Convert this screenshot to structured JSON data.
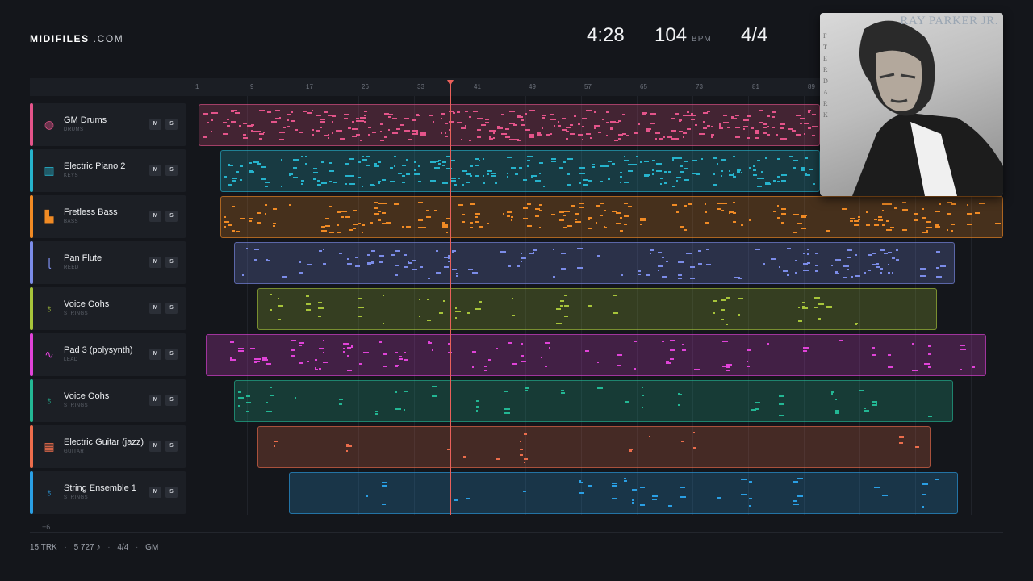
{
  "brand": {
    "name_bold": "MIDIFILES",
    "name_light": ".COM"
  },
  "header": {
    "time": "4:28",
    "bpm": "104",
    "bpm_label": "BPM",
    "signature": "4/4"
  },
  "album": {
    "artist_text": "RAY PARKER JR.",
    "title_letters": [
      "F",
      "T",
      "E",
      "R",
      "D",
      "A",
      "R",
      "K"
    ]
  },
  "ruler": {
    "ticks": [
      "1",
      "9",
      "17",
      "26",
      "33",
      "41",
      "49",
      "57",
      "65",
      "73",
      "81",
      "89"
    ]
  },
  "colors": {
    "drums": "#e4548a",
    "keys": "#26b3cc",
    "bass": "#f08a24",
    "reed": "#7b8ce8",
    "strings_lime": "#a7c43a",
    "lead": "#e043d8",
    "strings_teal": "#23b794",
    "guitar": "#ec6d4c",
    "strings_blue": "#2a9fe4",
    "playhead": "#e9605a"
  },
  "tracks": [
    {
      "name": "GM Drums",
      "category": "DRUMS",
      "icon": "drum-icon",
      "glyph": "◍",
      "color": "#e4548a",
      "mute": "M",
      "solo": "S"
    },
    {
      "name": "Electric Piano 2",
      "category": "KEYS",
      "icon": "piano-icon",
      "glyph": "▥",
      "color": "#26b3cc",
      "mute": "M",
      "solo": "S"
    },
    {
      "name": "Fretless Bass",
      "category": "BASS",
      "icon": "bass-amp-icon",
      "glyph": "▙",
      "color": "#f08a24",
      "mute": "M",
      "solo": "S"
    },
    {
      "name": "Pan Flute",
      "category": "REED",
      "icon": "flute-icon",
      "glyph": "ɭ",
      "color": "#7b8ce8",
      "mute": "M",
      "solo": "S"
    },
    {
      "name": "Voice Oohs",
      "category": "STRINGS",
      "icon": "guitar-icon",
      "glyph": "♁",
      "color": "#a7c43a",
      "mute": "M",
      "solo": "S"
    },
    {
      "name": "Pad 3 (polysynth)",
      "category": "LEAD",
      "icon": "waveform-icon",
      "glyph": "∿",
      "color": "#e043d8",
      "mute": "M",
      "solo": "S"
    },
    {
      "name": "Voice Oohs",
      "category": "STRINGS",
      "icon": "guitar-icon",
      "glyph": "♁",
      "color": "#23b794",
      "mute": "M",
      "solo": "S"
    },
    {
      "name": "Electric Guitar (jazz)",
      "category": "GUITAR",
      "icon": "fretboard-icon",
      "glyph": "▦",
      "color": "#ec6d4c",
      "mute": "M",
      "solo": "S"
    },
    {
      "name": "String Ensemble 1",
      "category": "STRINGS",
      "icon": "guitar-icon",
      "glyph": "♁",
      "color": "#2a9fe4",
      "mute": "M",
      "solo": "S"
    }
  ],
  "more_tracks": "+6",
  "footer": {
    "tracks": "15 TRK",
    "notes": "5 727 ♪",
    "signature": "4/4",
    "standard": "GM",
    "separator": "·"
  }
}
